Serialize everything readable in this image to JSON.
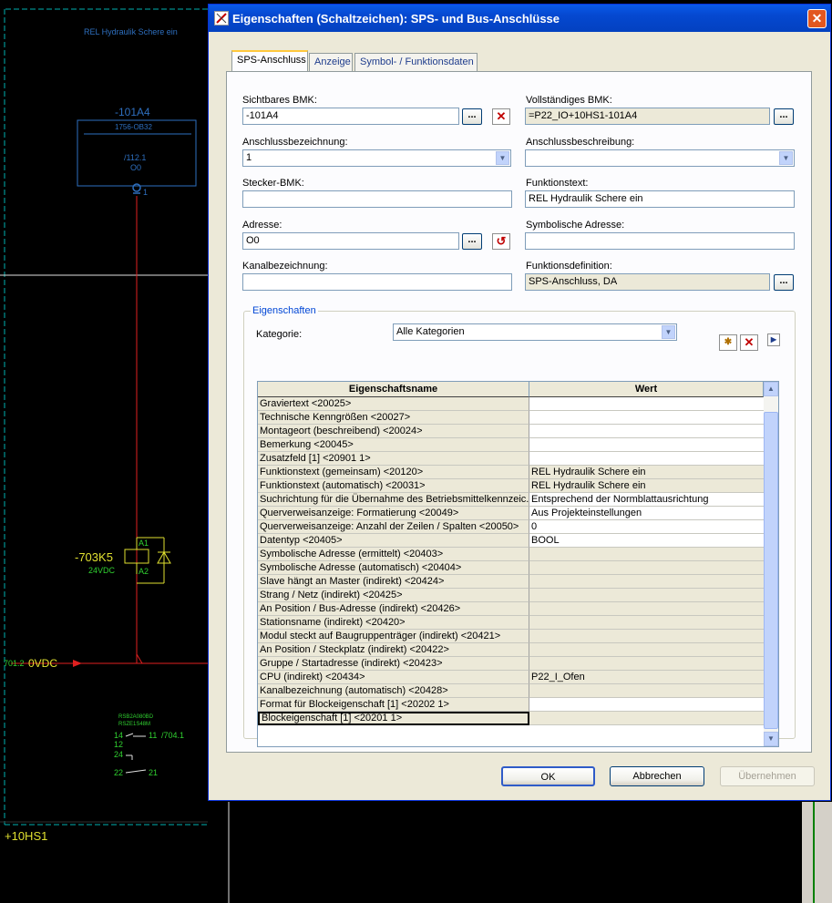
{
  "cad": {
    "title_text": "REL Hydraulik Schere ein",
    "plc_bmk": "-101A4",
    "plc_type": "1756-OB32",
    "plc_ref": "/112.1",
    "plc_address": "O0",
    "plc_pin": "1",
    "relay_name": "-703K5",
    "relay_voltage": "24VDC",
    "relay_a1": "A1",
    "relay_a2": "A2",
    "potential_ref": "701.2",
    "potential_name": "0VDC",
    "contact_type1": "RSB2A080BD",
    "contact_type2": "RSZE1S48M",
    "contact_14": "14",
    "contact_11": "11",
    "contact_ref": "/704.1",
    "contact_12": "12",
    "contact_24": "24",
    "contact_22": "22",
    "contact_21": "21",
    "location": "+10HS1"
  },
  "dialog": {
    "title": "Eigenschaften (Schaltzeichen): SPS- und Bus-Anschlüsse",
    "close_symbol": "✕",
    "tabs": [
      "SPS-Anschluss",
      "Anzeige",
      "Symbol- / Funktionsdaten"
    ],
    "fields": {
      "sichtbares_bmk_label": "Sichtbares BMK:",
      "sichtbares_bmk_value": "-101A4",
      "vollstaendiges_bmk_label": "Vollständiges BMK:",
      "vollstaendiges_bmk_value": "=P22_IO+10HS1-101A4",
      "anschlussbezeichnung_label": "Anschlussbezeichnung:",
      "anschlussbezeichnung_value": "1",
      "anschlussbeschreibung_label": "Anschlussbeschreibung:",
      "anschlussbeschreibung_value": "",
      "stecker_bmk_label": "Stecker-BMK:",
      "stecker_bmk_value": "",
      "funktionstext_label": "Funktionstext:",
      "funktionstext_value": "REL Hydraulik Schere ein",
      "adresse_label": "Adresse:",
      "adresse_value": "O0",
      "symbolische_adresse_label": "Symbolische Adresse:",
      "symbolische_adresse_value": "",
      "kanalbezeichnung_label": "Kanalbezeichnung:",
      "kanalbezeichnung_value": "",
      "funktionsdefinition_label": "Funktionsdefinition:",
      "funktionsdefinition_value": "SPS-Anschluss, DA"
    },
    "browse_label": "...",
    "properties": {
      "group_label": "Eigenschaften",
      "kategorie_label": "Kategorie:",
      "kategorie_value": "Alle Kategorien",
      "col_name": "Eigenschaftsname",
      "col_value": "Wert",
      "rows": [
        {
          "name": "Graviertext <20025>",
          "value": "",
          "editable": true
        },
        {
          "name": "Technische Kenngrößen <20027>",
          "value": "",
          "editable": true
        },
        {
          "name": "Montageort (beschreibend) <20024>",
          "value": "",
          "editable": true
        },
        {
          "name": "Bemerkung <20045>",
          "value": "",
          "editable": true
        },
        {
          "name": "Zusatzfeld [1] <20901 1>",
          "value": "",
          "editable": true
        },
        {
          "name": "Funktionstext (gemeinsam) <20120>",
          "value": "REL Hydraulik Schere ein",
          "editable": false
        },
        {
          "name": "Funktionstext (automatisch) <20031>",
          "value": "REL Hydraulik Schere ein",
          "editable": false
        },
        {
          "name": "Suchrichtung für die Übernahme des Betriebsmittelkennzeic...",
          "value": "Entsprechend der Normblattausrichtung",
          "editable": true
        },
        {
          "name": "Querverweisanzeige: Formatierung <20049>",
          "value": "Aus Projekteinstellungen",
          "editable": true
        },
        {
          "name": "Querverweisanzeige: Anzahl der Zeilen / Spalten <20050>",
          "value": "0",
          "editable": true
        },
        {
          "name": "Datentyp <20405>",
          "value": "BOOL",
          "editable": true
        },
        {
          "name": "Symbolische Adresse (ermittelt) <20403>",
          "value": "",
          "editable": false
        },
        {
          "name": "Symbolische Adresse (automatisch) <20404>",
          "value": "",
          "editable": false
        },
        {
          "name": "Slave hängt an Master (indirekt) <20424>",
          "value": "",
          "editable": false
        },
        {
          "name": "Strang / Netz (indirekt) <20425>",
          "value": "",
          "editable": false
        },
        {
          "name": "An Position / Bus-Adresse (indirekt) <20426>",
          "value": "",
          "editable": false
        },
        {
          "name": "Stationsname (indirekt) <20420>",
          "value": "",
          "editable": false
        },
        {
          "name": "Modul steckt auf Baugruppenträger (indirekt) <20421>",
          "value": "",
          "editable": false
        },
        {
          "name": "An Position / Steckplatz (indirekt) <20422>",
          "value": "",
          "editable": false
        },
        {
          "name": "Gruppe / Startadresse (indirekt) <20423>",
          "value": "",
          "editable": false
        },
        {
          "name": "CPU (indirekt) <20434>",
          "value": "P22_I_Ofen",
          "editable": false
        },
        {
          "name": "Kanalbezeichnung (automatisch) <20428>",
          "value": "",
          "editable": false
        },
        {
          "name": "Format für Blockeigenschaft [1] <20202 1>",
          "value": "",
          "editable": true
        },
        {
          "name": "Blockeigenschaft [1] <20201 1>",
          "value": "",
          "editable": false
        }
      ]
    },
    "buttons": {
      "ok": "OK",
      "cancel": "Abbrechen",
      "apply": "Übernehmen"
    }
  }
}
